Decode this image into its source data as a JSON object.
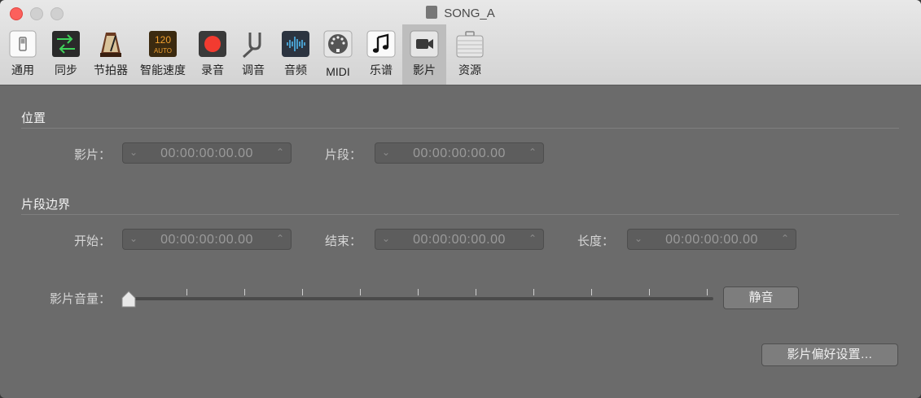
{
  "window": {
    "title": "SONG_A"
  },
  "toolbar": {
    "tabs": [
      {
        "label": "通用",
        "icon": "switch-icon"
      },
      {
        "label": "同步",
        "icon": "sync-arrows-icon"
      },
      {
        "label": "节拍器",
        "icon": "metronome-icon"
      },
      {
        "label": "智能速度",
        "icon": "smart-tempo-icon",
        "badge_top": "120",
        "badge_bottom": "AUTO"
      },
      {
        "label": "录音",
        "icon": "record-icon"
      },
      {
        "label": "调音",
        "icon": "tuning-fork-icon"
      },
      {
        "label": "音频",
        "icon": "audio-waveform-icon"
      },
      {
        "label": "MIDI",
        "icon": "midi-connector-icon"
      },
      {
        "label": "乐谱",
        "icon": "music-note-icon"
      },
      {
        "label": "影片",
        "icon": "video-camera-icon",
        "selected": true
      },
      {
        "label": "资源",
        "icon": "briefcase-icon"
      }
    ]
  },
  "position": {
    "title": "位置",
    "movie_label": "影片：",
    "movie_value": "00:00:00:00.00",
    "segment_label": "片段：",
    "segment_value": "00:00:00:00.00"
  },
  "bounds": {
    "title": "片段边界",
    "start_label": "开始：",
    "start_value": "00:00:00:00.00",
    "end_label": "结束：",
    "end_value": "00:00:00:00.00",
    "length_label": "长度：",
    "length_value": "00:00:00:00.00"
  },
  "volume": {
    "label": "影片音量：",
    "level": 0,
    "mute_label": "静音"
  },
  "prefs_button": "影片偏好设置…",
  "colors": {
    "record_red": "#f23b30",
    "sync_green": "#3fd25a",
    "waveform_blue": "#4fb8f0"
  }
}
